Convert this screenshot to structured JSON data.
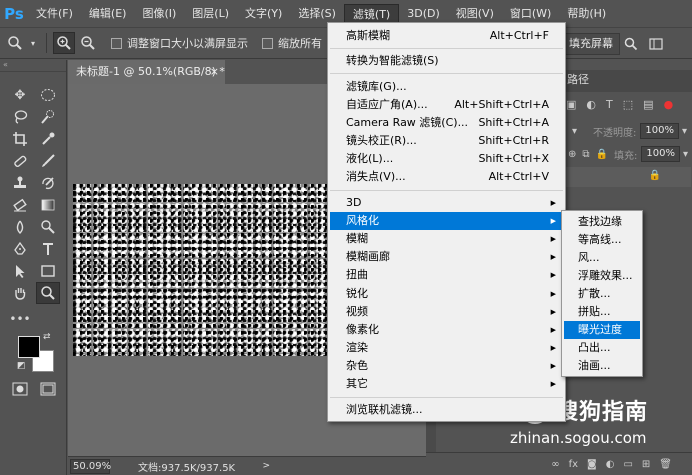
{
  "menubar": {
    "logo": "Ps",
    "items": [
      "文件(F)",
      "编辑(E)",
      "图像(I)",
      "图层(L)",
      "文字(Y)",
      "选择(S)",
      "滤镜(T)",
      "3D(D)",
      "视图(V)",
      "窗口(W)",
      "帮助(H)"
    ],
    "active_index": 6
  },
  "options": {
    "resize_windows_label": "调整窗口大小以满屏显示",
    "zoom_all_label": "缩放所有",
    "fill_screen_label": "填充屏幕"
  },
  "document": {
    "tab_title": "未标题-1 @ 50.1%(RGB/8) *",
    "close_glyph": "×",
    "zoom": "50.09%",
    "doc_size": "文档:937.5K/937.5K"
  },
  "right_panel": {
    "paths_tab": "路径",
    "opacity_label": "不透明度:",
    "opacity_value": "100%",
    "fill_label": "填充:",
    "fill_value": "100%"
  },
  "filter_menu": {
    "last_filter": {
      "label": "高斯模糊",
      "shortcut": "Alt+Ctrl+F"
    },
    "convert_smart": "转换为智能滤镜(S)",
    "group1": [
      {
        "label": "滤镜库(G)...",
        "shortcut": ""
      },
      {
        "label": "自适应广角(A)...",
        "shortcut": "Alt+Shift+Ctrl+A"
      },
      {
        "label": "Camera Raw 滤镜(C)...",
        "shortcut": "Shift+Ctrl+A"
      },
      {
        "label": "镜头校正(R)...",
        "shortcut": "Shift+Ctrl+R"
      },
      {
        "label": "液化(L)...",
        "shortcut": "Shift+Ctrl+X"
      },
      {
        "label": "消失点(V)...",
        "shortcut": "Alt+Ctrl+V"
      }
    ],
    "group2": [
      "3D",
      "风格化",
      "模糊",
      "模糊画廊",
      "扭曲",
      "锐化",
      "视频",
      "像素化",
      "渲染",
      "杂色",
      "其它"
    ],
    "group2_highlight_index": 1,
    "browse_online": "浏览联机滤镜..."
  },
  "stylize_submenu": {
    "items": [
      "查找边缘",
      "等高线...",
      "风...",
      "浮雕效果...",
      "扩散...",
      "拼贴...",
      "曝光过度",
      "凸出...",
      "油画..."
    ],
    "highlight_index": 6
  },
  "watermark": {
    "logo": "S",
    "text": "搜狗指南",
    "url": "zhinan.sogou.com"
  }
}
